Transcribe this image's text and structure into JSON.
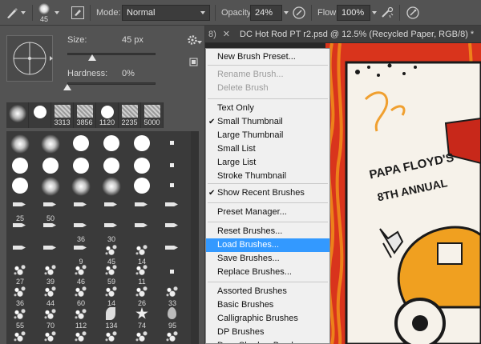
{
  "options_bar": {
    "brush_size": "45",
    "mode_label": "Mode:",
    "mode_value": "Normal",
    "opacity_label": "Opacity:",
    "opacity_value": "24%",
    "flow_label": "Flow:",
    "flow_value": "100%"
  },
  "brush_panel": {
    "size_label": "Size:",
    "size_value": "45 px",
    "hardness_label": "Hardness:",
    "hardness_value": "0%",
    "size_level": 0.28,
    "hardness_level": 0.0,
    "recent_sizes": [
      "",
      "",
      "3313",
      "3856",
      "1120",
      "2235",
      "5000"
    ],
    "grid_numbers": [
      [
        "",
        "",
        "",
        "",
        "",
        ""
      ],
      [
        "",
        "",
        "",
        "",
        "",
        ""
      ],
      [
        "",
        "",
        "",
        "",
        "",
        ""
      ],
      [
        "25",
        "50",
        "",
        "",
        "",
        ""
      ],
      [
        "",
        "",
        "36",
        "30",
        "",
        ""
      ],
      [
        "",
        "",
        "9",
        "45",
        "14",
        ""
      ],
      [
        "27",
        "39",
        "46",
        "59",
        "11",
        ""
      ],
      [
        "36",
        "44",
        "60",
        "14",
        "26",
        "33"
      ],
      [
        "55",
        "70",
        "112",
        "134",
        "74",
        "95"
      ],
      [
        "",
        "",
        "",
        "",
        "",
        ""
      ]
    ]
  },
  "document_tab": {
    "prefix": "8)",
    "title": "DC Hot Rod PT r2.psd @ 12.5% (Recycled Paper, RGB/8) *"
  },
  "canvas": {
    "poster_line1": "PAPA FLOYD'S",
    "poster_line2": "8TH ANNUAL"
  },
  "menu": {
    "items": [
      {
        "label": "New Brush Preset...",
        "disabled": false,
        "checked": false,
        "highlighted": false
      },
      {
        "label": "Rename Brush...",
        "disabled": true,
        "checked": false,
        "highlighted": false
      },
      {
        "label": "Delete Brush",
        "disabled": true,
        "checked": false,
        "highlighted": false
      },
      {
        "label": "Text Only",
        "disabled": false,
        "checked": false,
        "highlighted": false
      },
      {
        "label": "Small Thumbnail",
        "disabled": false,
        "checked": true,
        "highlighted": false
      },
      {
        "label": "Large Thumbnail",
        "disabled": false,
        "checked": false,
        "highlighted": false
      },
      {
        "label": "Small List",
        "disabled": false,
        "checked": false,
        "highlighted": false
      },
      {
        "label": "Large List",
        "disabled": false,
        "checked": false,
        "highlighted": false
      },
      {
        "label": "Stroke Thumbnail",
        "disabled": false,
        "checked": false,
        "highlighted": false
      },
      {
        "label": "Show Recent Brushes",
        "disabled": false,
        "checked": true,
        "highlighted": false
      },
      {
        "label": "Preset Manager...",
        "disabled": false,
        "checked": false,
        "highlighted": false
      },
      {
        "label": "Reset Brushes...",
        "disabled": false,
        "checked": false,
        "highlighted": false
      },
      {
        "label": "Load Brushes...",
        "disabled": false,
        "checked": false,
        "highlighted": true
      },
      {
        "label": "Save Brushes...",
        "disabled": false,
        "checked": false,
        "highlighted": false
      },
      {
        "label": "Replace Brushes...",
        "disabled": false,
        "checked": false,
        "highlighted": false
      },
      {
        "label": "Assorted Brushes",
        "disabled": false,
        "checked": false,
        "highlighted": false
      },
      {
        "label": "Basic Brushes",
        "disabled": false,
        "checked": false,
        "highlighted": false
      },
      {
        "label": "Calligraphic Brushes",
        "disabled": false,
        "checked": false,
        "highlighted": false
      },
      {
        "label": "DP Brushes",
        "disabled": false,
        "checked": false,
        "highlighted": false
      },
      {
        "label": "Drop Shadow Brushes",
        "disabled": false,
        "checked": false,
        "highlighted": false
      }
    ]
  },
  "colors": {
    "menu_highlight": "#3399ff",
    "panel_bg": "#535353",
    "poster_red": "#d9341c",
    "poster_orange": "#f08a1a"
  }
}
